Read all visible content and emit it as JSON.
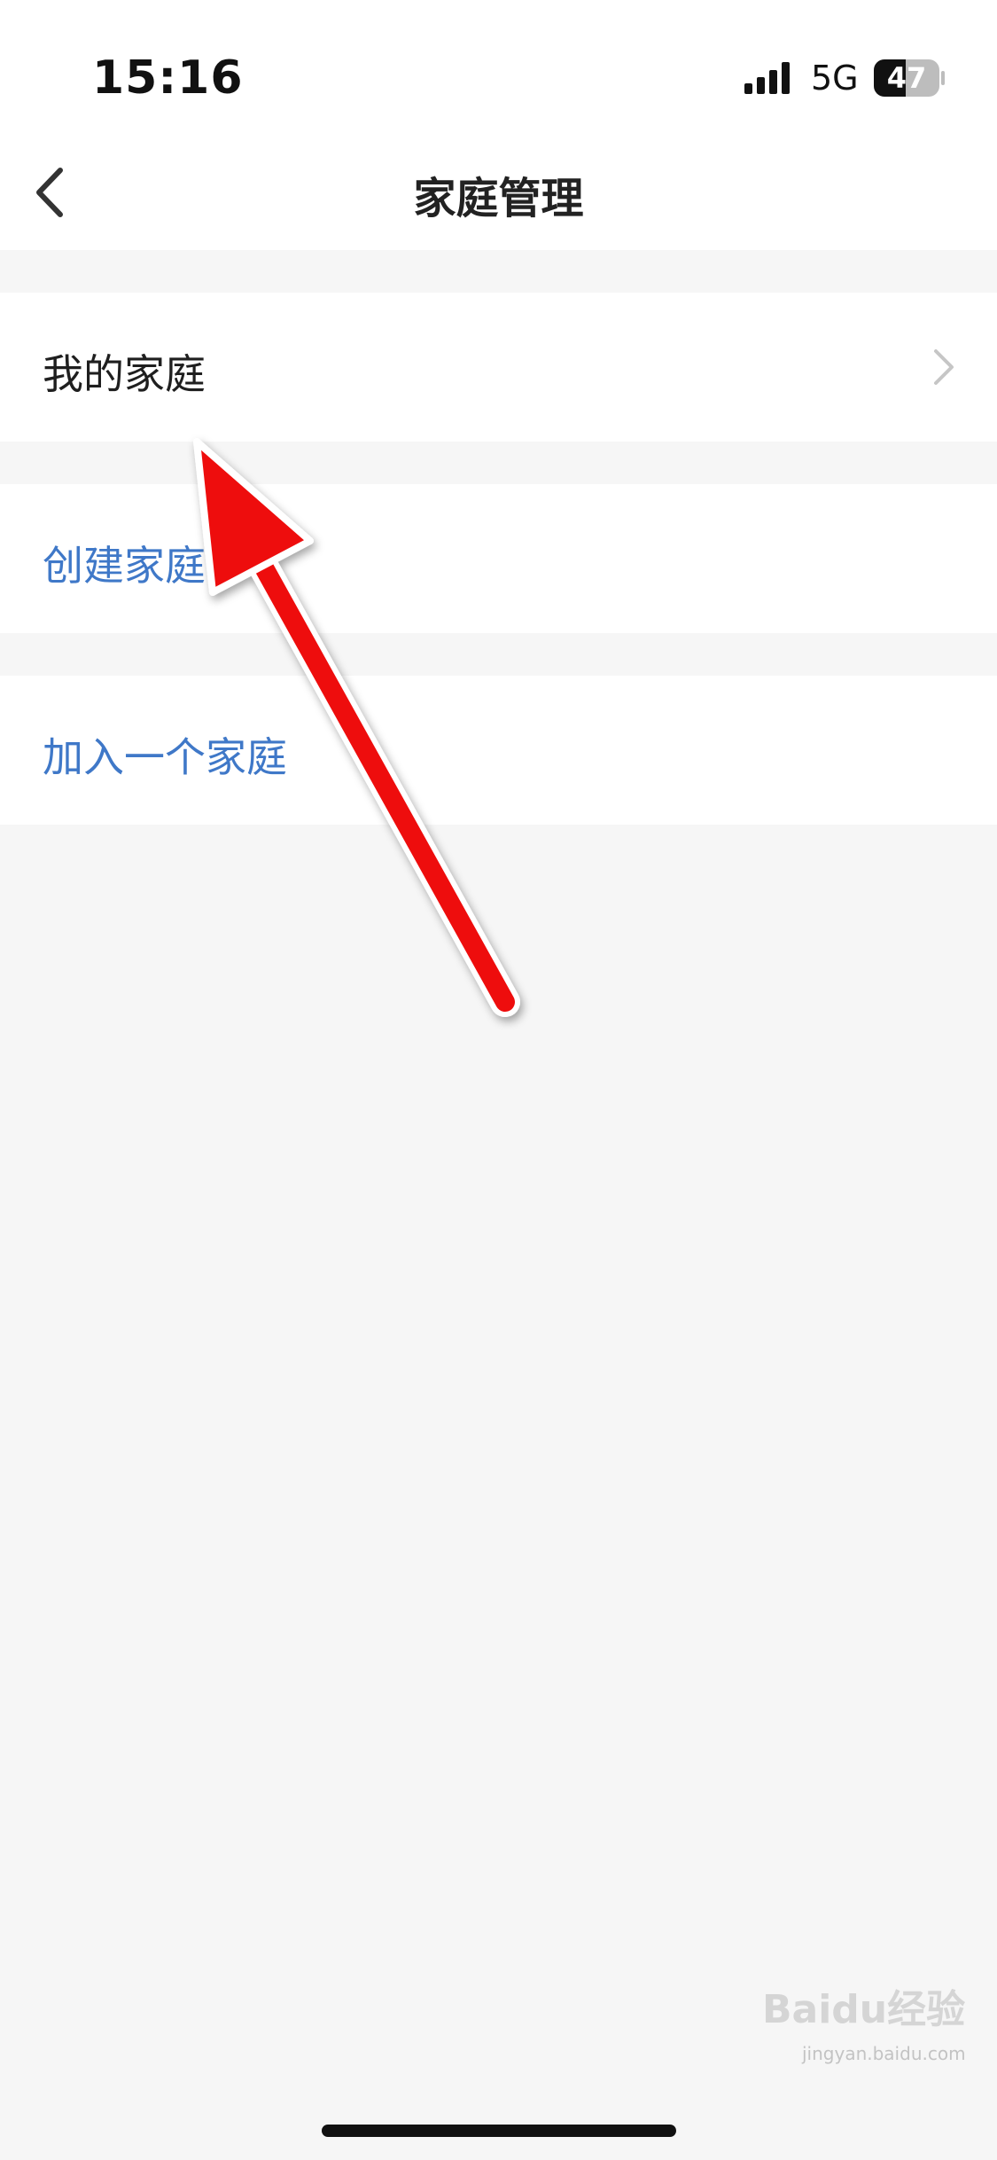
{
  "status_bar": {
    "time": "15:16",
    "network": "5G",
    "battery": "47"
  },
  "header": {
    "title": "家庭管理",
    "back_icon": "chevron-left-icon"
  },
  "menu": {
    "items": [
      {
        "label": "我的家庭",
        "color": "#1f1f1f",
        "icon": "chevron-right-icon"
      },
      {
        "label": "创建家庭",
        "color": "#3f78c8"
      },
      {
        "label": "加入一个家庭",
        "color": "#3f78c8"
      }
    ]
  },
  "annotation": {
    "type": "red-arrow",
    "color": "#ee1111",
    "points_to": "我的家庭"
  },
  "watermark": {
    "logo_text": "Baidu经验",
    "url": "jingyan.baidu.com"
  },
  "colors": {
    "background": "#f6f6f6",
    "row_background": "#ffffff",
    "link_blue": "#3f78c8"
  }
}
